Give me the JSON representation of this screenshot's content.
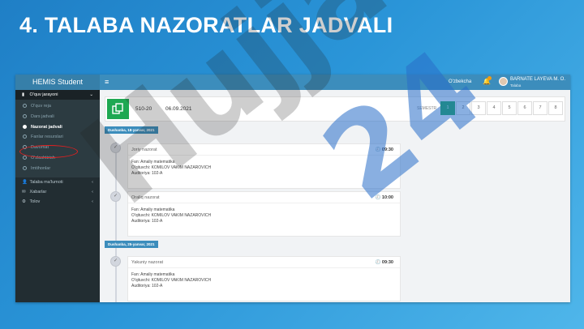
{
  "slide": {
    "title": "4. TALABA NAZORATLAR JADVALI"
  },
  "watermarks": {
    "dark": "Hujjat",
    "blue": "24"
  },
  "topbar": {
    "brand": "HEMIS Student",
    "menu_icon": "≡",
    "language": "O'zbekcha",
    "user_name": "BARNATE LAYEVA M. O.",
    "user_role": "Talaba"
  },
  "sidebar": {
    "groups": [
      {
        "label": "O'quv jarayoni",
        "icon": "book-icon"
      },
      {
        "label": "Talaba ma'lumoti",
        "icon": "user-icon"
      },
      {
        "label": "Xabarlar",
        "icon": "envelope-icon"
      },
      {
        "label": "Tolov",
        "icon": "gear-icon"
      }
    ],
    "sub_items": [
      {
        "label": "O'quv reja"
      },
      {
        "label": "Dars jadvali"
      },
      {
        "label": "Nazorat jadvali"
      },
      {
        "label": "Fanlar resurslari"
      },
      {
        "label": "Davomat"
      },
      {
        "label": "O'zlashtirish"
      },
      {
        "label": "Imtihonlar"
      }
    ],
    "current_item": "Nazorat jadvali"
  },
  "filter": {
    "group_code": "510-20",
    "date": "06.09.2021",
    "semestr_label": "SEMESTR",
    "pages": [
      "1",
      "2",
      "3",
      "4",
      "5",
      "6",
      "7",
      "8"
    ],
    "active_page": "1"
  },
  "dates": [
    {
      "label": "Dushanba, 18-yanvar, 2021"
    },
    {
      "label": "Dushanba, 25-yanvar, 2021"
    }
  ],
  "events": [
    {
      "type": "Joriy nazorat",
      "time": "09:30",
      "subject": "Fan: Amaliy matematika",
      "teacher": "O'qituvchi: KOMILOV VAKIM NAZAROVICH",
      "room": "Auditoriya: 102-A"
    },
    {
      "type": "Oraliq nazorat",
      "time": "10:00",
      "subject": "Fan: Amaliy matematika",
      "teacher": "O'qituvchi: KOMILOV VAKIM NAZAROVICH",
      "room": "Auditoriya: 102-A"
    },
    {
      "type": "Yakuniy nazorat",
      "time": "09:30",
      "subject": "Fan: Amaliy matematika",
      "teacher": "O'qituvchi: KOMILOV VAKIM NAZAROVICH",
      "room": "Auditoriya: 102-A"
    }
  ],
  "colors": {
    "accent": "#3c8dbc",
    "sidebar": "#222d32",
    "success": "#1ea852",
    "highlight": "#e02020"
  }
}
